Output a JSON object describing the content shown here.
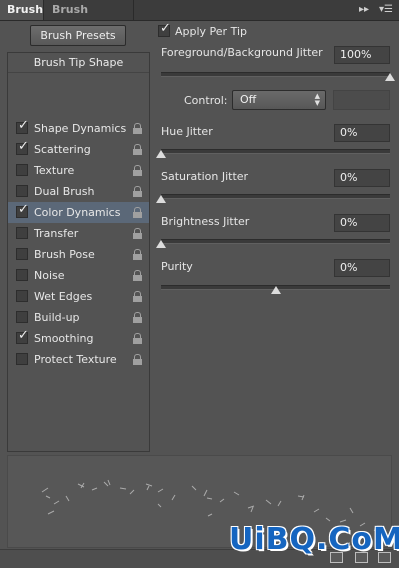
{
  "tabs": {
    "active": "Brush",
    "inactive": "Brush Presets"
  },
  "toolbar": {
    "collapse_icon": "double-chevron-right-icon",
    "menu_icon": "panel-menu-icon"
  },
  "left": {
    "brush_presets_button": "Brush Presets",
    "list_header": "Brush Tip Shape",
    "items": [
      {
        "label": "Shape Dynamics",
        "checked": true,
        "selected": false
      },
      {
        "label": "Scattering",
        "checked": true,
        "selected": false
      },
      {
        "label": "Texture",
        "checked": false,
        "selected": false
      },
      {
        "label": "Dual Brush",
        "checked": false,
        "selected": false
      },
      {
        "label": "Color Dynamics",
        "checked": true,
        "selected": true
      },
      {
        "label": "Transfer",
        "checked": false,
        "selected": false
      },
      {
        "label": "Brush Pose",
        "checked": false,
        "selected": false
      },
      {
        "label": "Noise",
        "checked": false,
        "selected": false
      },
      {
        "label": "Wet Edges",
        "checked": false,
        "selected": false
      },
      {
        "label": "Build-up",
        "checked": false,
        "selected": false
      },
      {
        "label": "Smoothing",
        "checked": true,
        "selected": false
      },
      {
        "label": "Protect Texture",
        "checked": false,
        "selected": false
      }
    ]
  },
  "right": {
    "apply_per_tip": {
      "label": "Apply Per Tip",
      "checked": true
    },
    "fg_bg_jitter": {
      "label": "Foreground/Background Jitter",
      "value": "100%",
      "level": 1.0
    },
    "control": {
      "label": "Control:",
      "selected": "Off"
    },
    "hue_jitter": {
      "label": "Hue Jitter",
      "value": "0%",
      "level": 0.0
    },
    "saturation_jitter": {
      "label": "Saturation Jitter",
      "value": "0%",
      "level": 0.0
    },
    "brightness_jitter": {
      "label": "Brightness Jitter",
      "value": "0%",
      "level": 0.0
    },
    "purity": {
      "label": "Purity",
      "value": "0%",
      "level": 0.5
    }
  },
  "watermark": "UiBQ.CoM",
  "colors": {
    "panel_bg": "#535353",
    "selected_row": "#5b6878",
    "watermark_blue": "#1565c0"
  }
}
